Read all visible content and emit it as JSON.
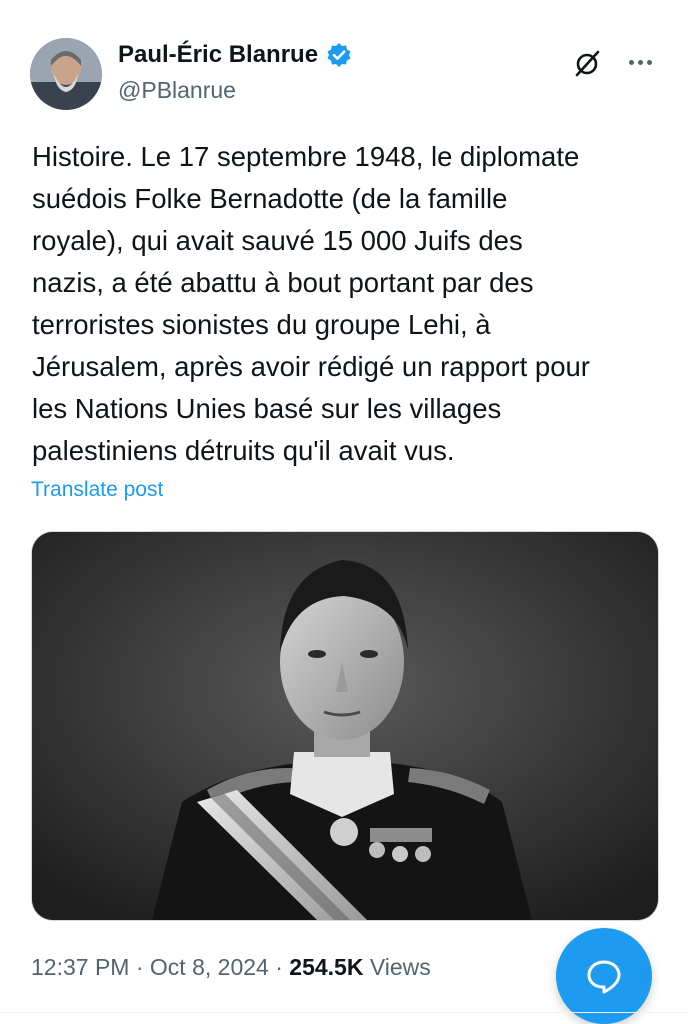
{
  "author": {
    "name": "Paul-Éric Blanrue",
    "handle": "@PBlanrue",
    "verified": true
  },
  "post": {
    "text": "Histoire. Le 17 septembre 1948, le diplomate\nsuédois Folke Bernadotte (de la famille\nroyale), qui avait sauvé 15 000 Juifs des\nnazis, a été abattu à bout portant par des\nterroristes sionistes du groupe Lehi, à\nJérusalem, après avoir rédigé un rapport pour\nles Nations Unies basé sur les villages\npalestiniens détruits qu'il avait vus.",
    "translate_label": "Translate post",
    "media": {
      "description_icon": "black-and-white-portrait-photo"
    }
  },
  "meta": {
    "time": "12:37 PM",
    "separator": "·",
    "date": "Oct 8, 2024",
    "views_count": "254.5K",
    "views_label": "Views"
  },
  "icons": {
    "verified": "verified-badge-icon",
    "grok": "grok-icon",
    "more": "more-options-icon",
    "compose": "reply-compose-icon"
  },
  "colors": {
    "accent": "#1d9bf0",
    "text": "#0f1419",
    "secondary": "#536471"
  }
}
